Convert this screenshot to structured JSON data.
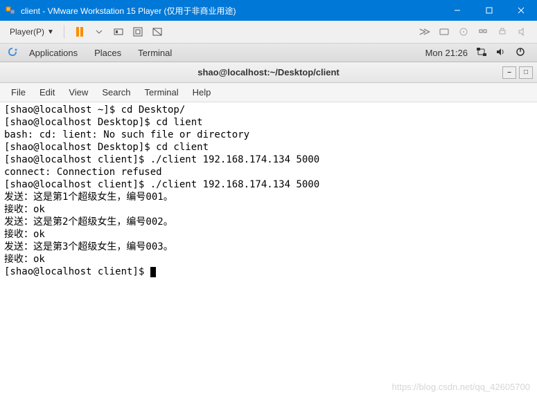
{
  "vmware": {
    "title": "client - VMware Workstation 15 Player (仅用于非商业用途)",
    "player_menu": "Player(P)"
  },
  "gnome": {
    "applications": "Applications",
    "places": "Places",
    "terminal": "Terminal",
    "clock": "Mon 21:26"
  },
  "terminal": {
    "title": "shao@localhost:~/Desktop/client",
    "menu": {
      "file": "File",
      "edit": "Edit",
      "view": "View",
      "search": "Search",
      "terminal": "Terminal",
      "help": "Help"
    },
    "lines": [
      "[shao@localhost ~]$ cd Desktop/",
      "[shao@localhost Desktop]$ cd lient",
      "bash: cd: lient: No such file or directory",
      "[shao@localhost Desktop]$ cd client",
      "[shao@localhost client]$ ./client 192.168.174.134 5000",
      "connect: Connection refused",
      "[shao@localhost client]$ ./client 192.168.174.134 5000",
      "发送：这是第1个超级女生，编号001。",
      "接收：ok",
      "发送：这是第2个超级女生，编号002。",
      "接收：ok",
      "发送：这是第3个超级女生，编号003。",
      "接收：ok",
      "[shao@localhost client]$ "
    ]
  },
  "watermark": "https://blog.csdn.net/qq_42605700"
}
